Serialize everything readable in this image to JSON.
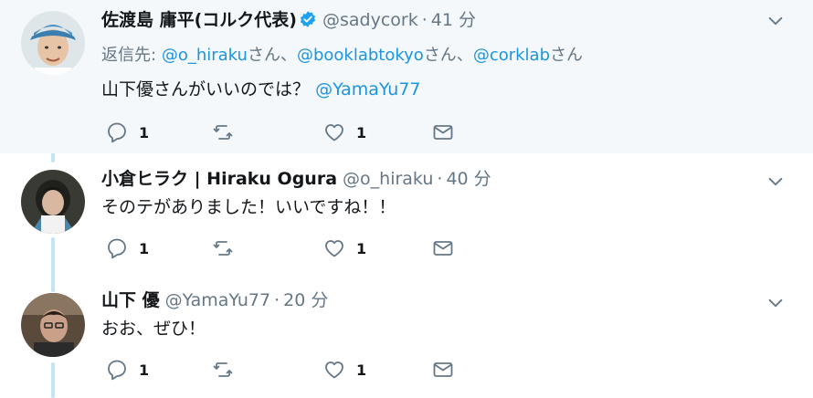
{
  "tweets": [
    {
      "display_name": "佐渡島 庸平(コルク代表)",
      "verified": true,
      "handle": "@sadycork",
      "separator": "·",
      "time": "41 分",
      "reply_prefix": "返信先:",
      "reply_to": [
        {
          "handle": "@o_hiraku",
          "suffix": "さん、"
        },
        {
          "handle": "@booklabtokyo",
          "suffix": "さん、"
        },
        {
          "handle": "@corklab",
          "suffix": "さん"
        }
      ],
      "text": "山下優さんがいいのでは？",
      "mention": "@YamaYu77",
      "reply_count": "1",
      "like_count": "1"
    },
    {
      "display_name": "小倉ヒラク | Hiraku Ogura",
      "handle": "@o_hiraku",
      "separator": "·",
      "time": "40 分",
      "text": "そのテがありました！いいですね！！",
      "reply_count": "1",
      "like_count": "1"
    },
    {
      "display_name": "山下 優",
      "handle": "@YamaYu77",
      "separator": "·",
      "time": "20 分",
      "text": "おお、ぜひ！",
      "reply_count": "1",
      "like_count": "1"
    }
  ],
  "icons": [
    "reply-icon",
    "retweet-icon",
    "like-icon",
    "direct-message-icon",
    "chevron-down-icon",
    "verified-badge-icon"
  ],
  "colors": {
    "link": "#1b95e0",
    "muted": "#657786",
    "text": "#14171a",
    "highlight_bg": "#f5f8fa",
    "thread_line": "#c4e3f8"
  }
}
